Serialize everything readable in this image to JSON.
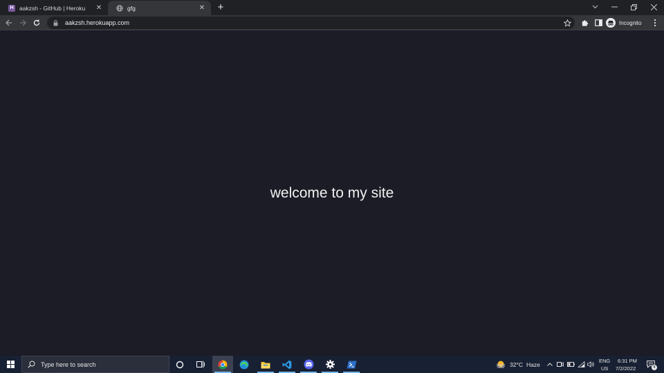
{
  "browser": {
    "tabs": [
      {
        "label": "aakzsh - GitHub | Heroku",
        "favicon": "heroku-icon",
        "favicon_text": "H"
      },
      {
        "label": "gfg",
        "favicon": "globe-icon"
      }
    ],
    "new_tab": "+",
    "address": "aakzsh.herokuapp.com",
    "profile_label": "Incognito"
  },
  "page": {
    "headline": "welcome to my site",
    "background": "#1b1c26"
  },
  "taskbar": {
    "search_placeholder": "Type here to search",
    "pinned_apps": [
      "chrome-icon",
      "edge-icon",
      "file-explorer-icon",
      "vscode-icon",
      "discord-icon",
      "settings-icon",
      "terminal-icon"
    ],
    "weather_temp": "32°C",
    "weather_desc": "Haze",
    "language_line1": "ENG",
    "language_line2": "US",
    "time": "6:31 PM",
    "date": "7/2/2022",
    "notification_count": "4"
  }
}
